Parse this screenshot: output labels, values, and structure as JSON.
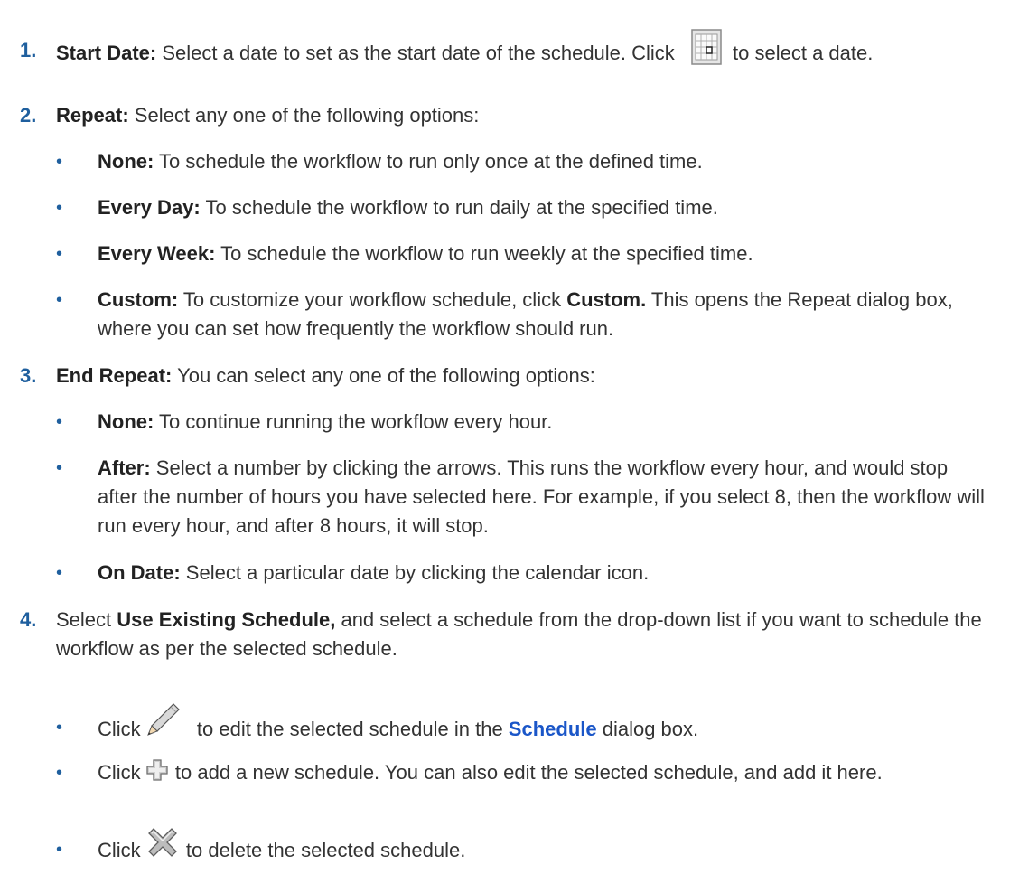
{
  "steps": [
    {
      "number": "1.",
      "label": "Start Date:",
      "text_a": " Select a date to set as the start date of the schedule. Click ",
      "icon": "calendar-icon",
      "text_b": " to select a date."
    },
    {
      "number": "2.",
      "label": "Repeat:",
      "text": " Select any one of the following options:",
      "options": [
        {
          "label": "None:",
          "text": " To schedule the workflow to run only once at the defined time."
        },
        {
          "label": "Every Day:",
          "text": " To schedule the workflow to run daily at the specified time."
        },
        {
          "label": "Every Week:",
          "text": " To schedule the workflow to run weekly at the specified time."
        },
        {
          "label": "Custom:",
          "text_a": " To customize your workflow schedule, click ",
          "bold": "Custom.",
          "text_b": " This opens the Repeat dialog box, where you can set how frequently the workflow should run."
        }
      ]
    },
    {
      "number": "3.",
      "label": "End Repeat:",
      "text": " You can select any one of the following options:",
      "options": [
        {
          "label": "None:",
          "text": " To continue running the workflow every hour."
        },
        {
          "label": "After:",
          "text": " Select a number by clicking the arrows. This runs the workflow every hour, and would stop after the number of hours you have selected here. For example, if you select 8, then the workflow will run every hour, and after 8 hours, it will stop."
        },
        {
          "label": "On Date:",
          "text": " Select a particular date by clicking the calendar icon."
        }
      ]
    },
    {
      "number": "4.",
      "text_a": "Select ",
      "bold": "Use Existing Schedule,",
      "text_b": " and select a schedule from the drop-down list if you want to schedule the workflow as per the selected schedule.",
      "actions": [
        {
          "prefix": "Click ",
          "icon": "pencil-icon",
          "text_a": " to edit the selected schedule in the ",
          "link": "Schedule",
          "text_b": " dialog box."
        },
        {
          "prefix": "Click ",
          "icon": "plus-icon",
          "text": " to add a new schedule. You can also edit the selected schedule, and add it here."
        },
        {
          "prefix": "Click ",
          "icon": "x-icon",
          "text": " to delete the selected schedule."
        }
      ]
    }
  ],
  "bullet_char": "•",
  "colors": {
    "number": "#1f5f9e",
    "link": "#1a56c8",
    "text": "#333333"
  }
}
